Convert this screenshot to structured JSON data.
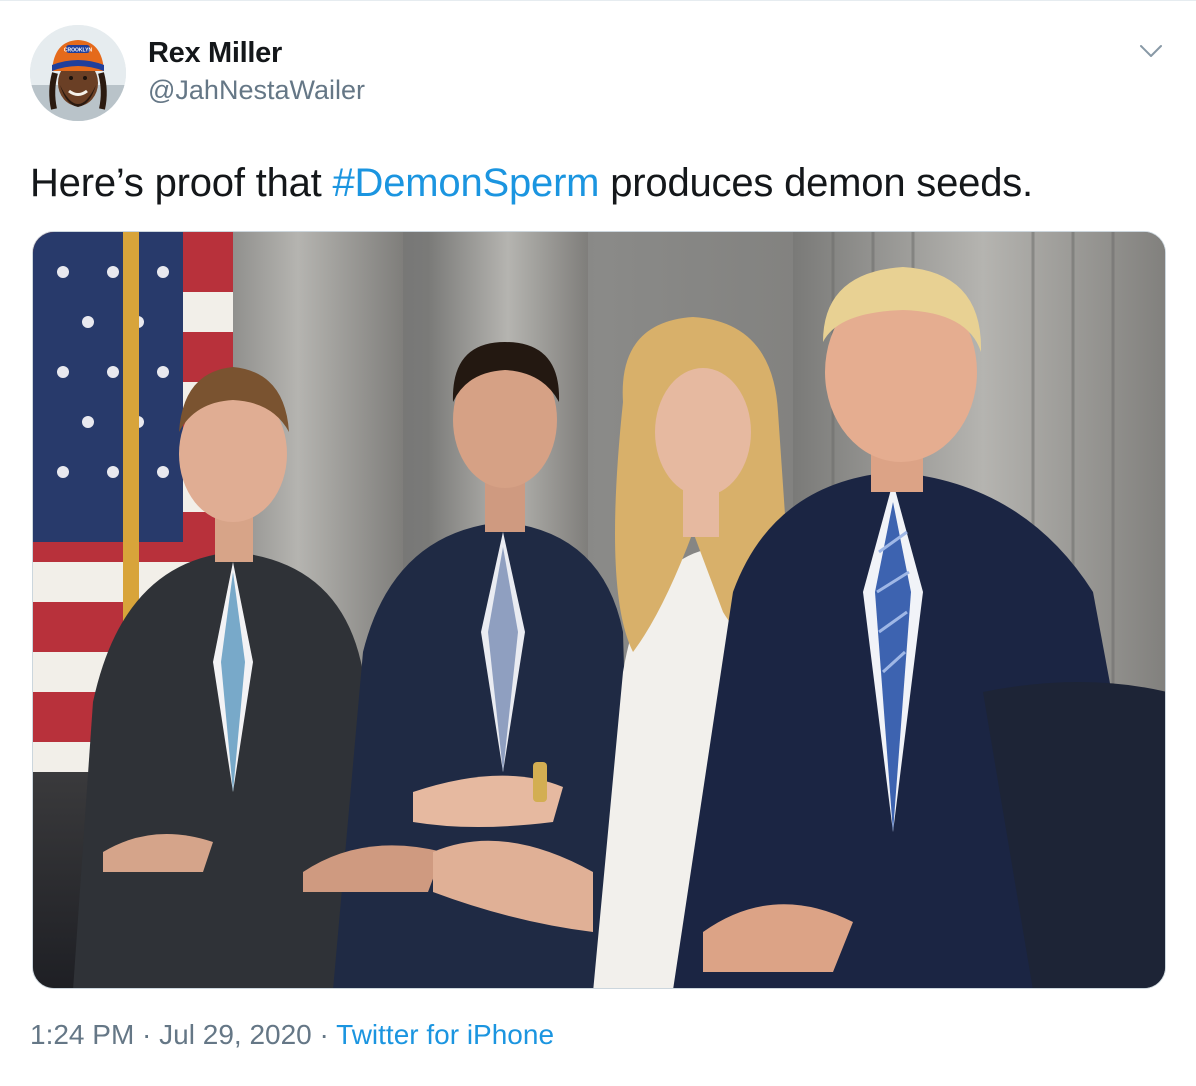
{
  "user": {
    "name": "Rex Miller",
    "handle": "@JahNestaWailer",
    "avatar_alt_icon": "user-avatar",
    "helmet_text": "CROOKLYN"
  },
  "tweet": {
    "text_before": "Here’s proof that ",
    "hashtag": "#DemonSperm",
    "text_after": " produces demon seeds."
  },
  "media": {
    "icon": "photo-image"
  },
  "meta": {
    "time": "1:24 PM",
    "separator": " · ",
    "date": "Jul 29, 2020",
    "separator2": " · ",
    "source": "Twitter for iPhone"
  },
  "menu": {
    "icon": "chevron-down-icon"
  },
  "colors": {
    "link": "#1b95e0",
    "secondary_text": "#657786",
    "border": "#ccd6dd"
  }
}
